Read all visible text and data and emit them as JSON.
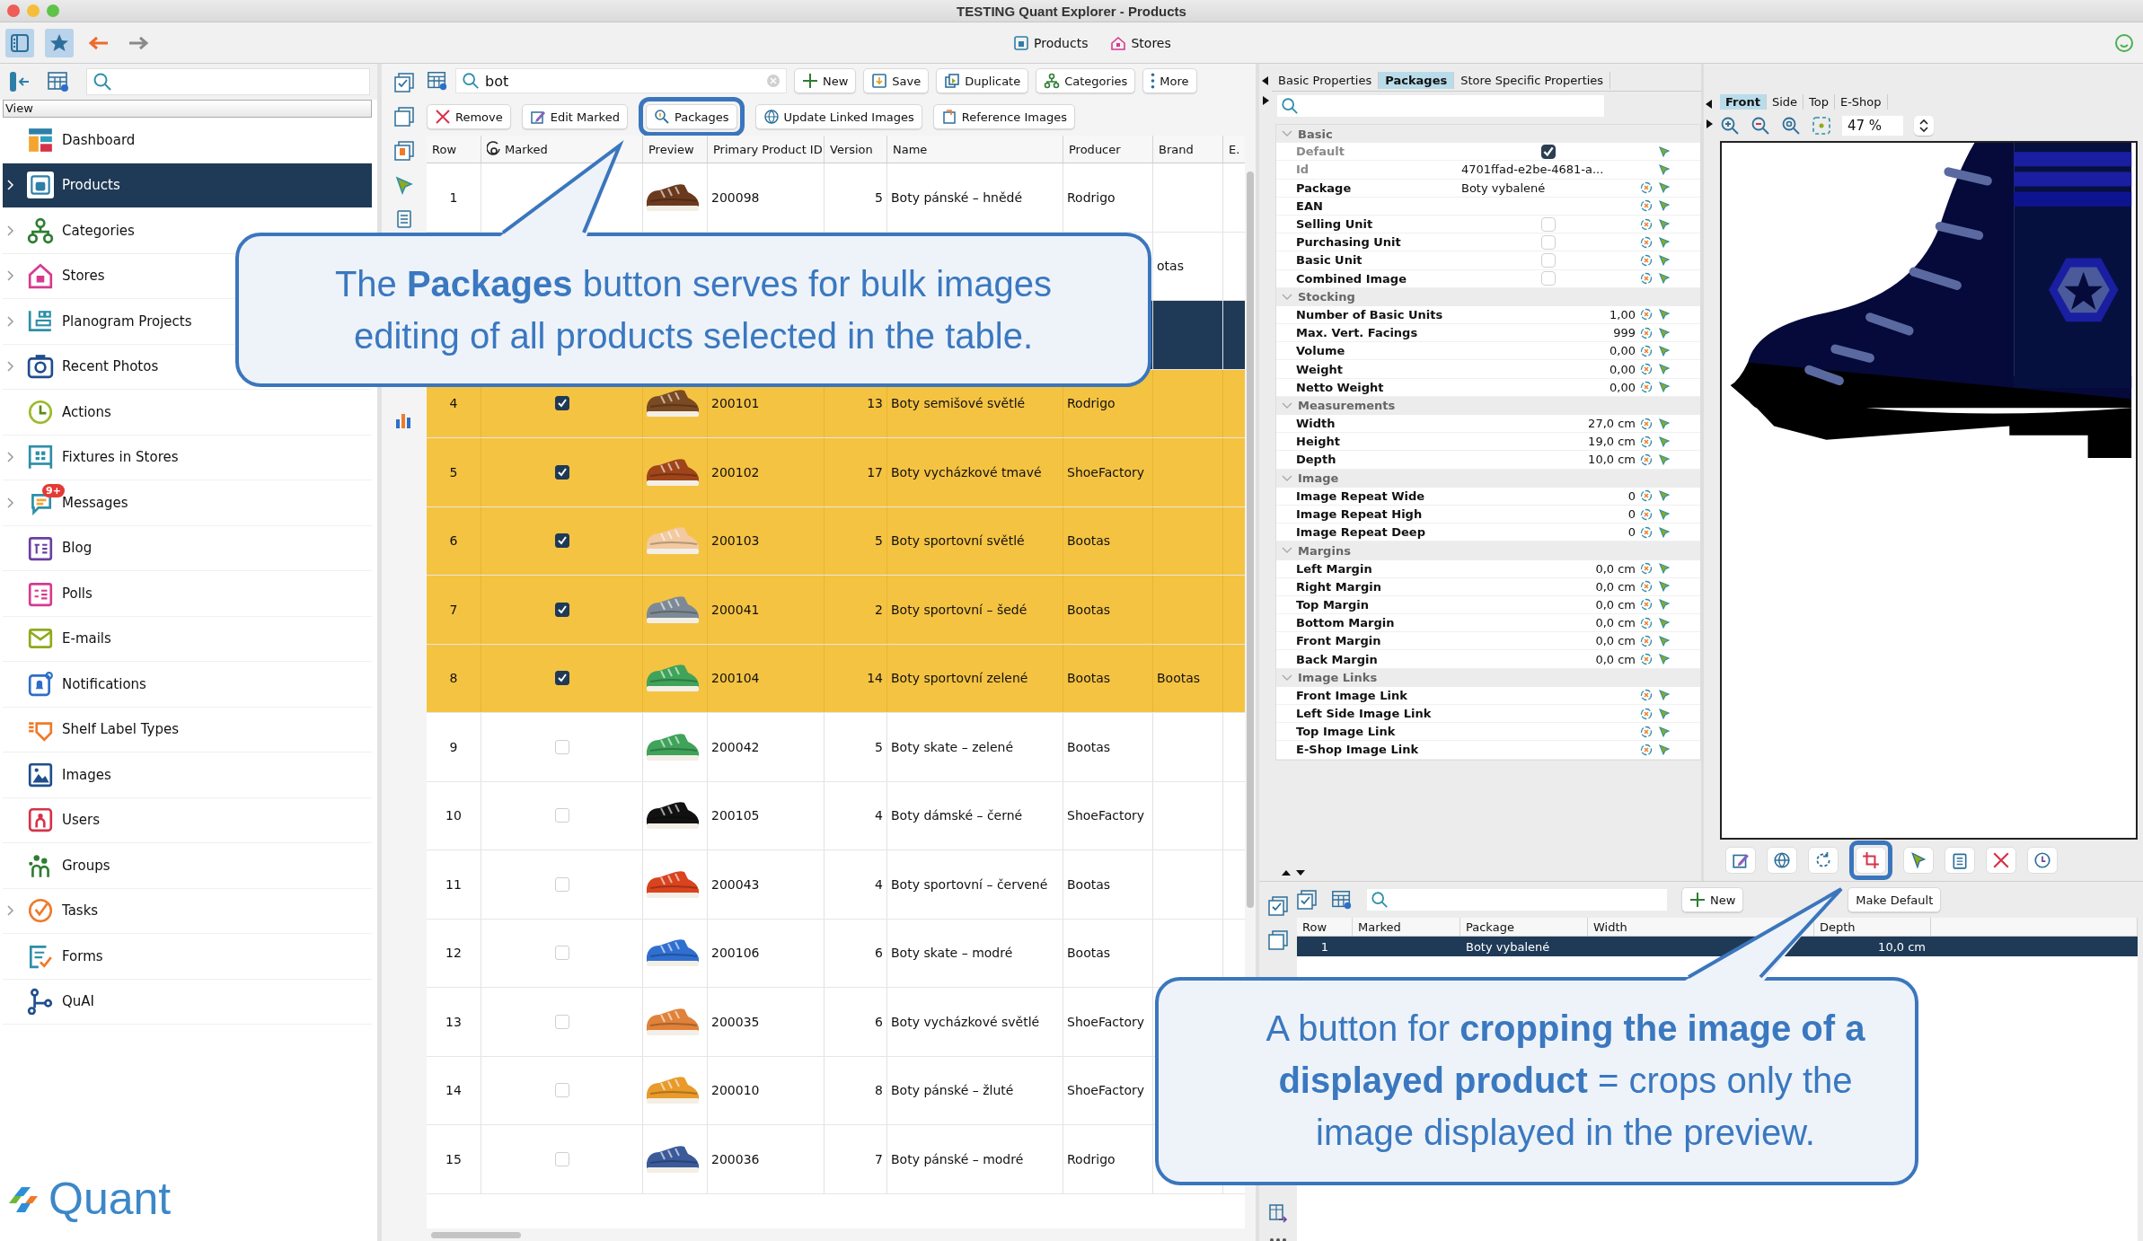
{
  "window": {
    "title": "TESTING Quant Explorer - Products"
  },
  "open_views": [
    {
      "label": "Products"
    },
    {
      "label": "Stores"
    }
  ],
  "sidebar": {
    "section": "View",
    "items": [
      {
        "label": "Dashboard",
        "expandable": false,
        "selected": false
      },
      {
        "label": "Products",
        "expandable": true,
        "selected": true
      },
      {
        "label": "Categories",
        "expandable": true,
        "selected": false
      },
      {
        "label": "Stores",
        "expandable": true,
        "selected": false
      },
      {
        "label": "Planogram Projects",
        "expandable": true,
        "selected": false
      },
      {
        "label": "Recent Photos",
        "expandable": true,
        "selected": false
      },
      {
        "label": "Actions",
        "expandable": false,
        "selected": false
      },
      {
        "label": "Fixtures in Stores",
        "expandable": true,
        "selected": false
      },
      {
        "label": "Messages",
        "expandable": true,
        "selected": false,
        "badge": "9+"
      },
      {
        "label": "Blog",
        "expandable": false,
        "selected": false
      },
      {
        "label": "Polls",
        "expandable": false,
        "selected": false
      },
      {
        "label": "E-mails",
        "expandable": false,
        "selected": false
      },
      {
        "label": "Notifications",
        "expandable": false,
        "selected": false
      },
      {
        "label": "Shelf Label Types",
        "expandable": false,
        "selected": false
      },
      {
        "label": "Images",
        "expandable": false,
        "selected": false
      },
      {
        "label": "Users",
        "expandable": false,
        "selected": false
      },
      {
        "label": "Groups",
        "expandable": false,
        "selected": false
      },
      {
        "label": "Tasks",
        "expandable": true,
        "selected": false
      },
      {
        "label": "Forms",
        "expandable": false,
        "selected": false
      },
      {
        "label": "QuAI",
        "expandable": false,
        "selected": false
      }
    ],
    "logo": "Quant"
  },
  "products": {
    "search": {
      "value": "bot"
    },
    "buttons": [
      {
        "label": "New",
        "kind": "new"
      },
      {
        "label": "Save",
        "kind": "save"
      },
      {
        "label": "Duplicate",
        "kind": "duplicate"
      },
      {
        "label": "Categories",
        "kind": "categories"
      },
      {
        "label": "More",
        "kind": "more"
      }
    ],
    "actions": [
      {
        "label": "Remove",
        "kind": "remove",
        "highlighted": false
      },
      {
        "label": "Edit Marked",
        "kind": "edit",
        "highlighted": false
      },
      {
        "label": "Packages",
        "kind": "packages",
        "highlighted": true
      },
      {
        "label": "Update Linked Images",
        "kind": "globe",
        "highlighted": false
      },
      {
        "label": "Reference Images",
        "kind": "reference",
        "highlighted": false
      }
    ],
    "table": {
      "columns": [
        "Row",
        "Marked",
        "Preview",
        "Primary Product ID",
        "Version",
        "Name",
        "Producer",
        "Brand",
        "E."
      ],
      "rows": [
        {
          "row": "1",
          "id": "200098",
          "version": "5",
          "name": "Boty pánské – hnědé",
          "producer": "Rodrigo",
          "selected": false
        },
        {
          "brand": "otas",
          "selected": false
        },
        {
          "selected": true
        },
        {
          "row": "4",
          "marked": true,
          "id": "200101",
          "version": "13",
          "name": "Boty semišové světlé",
          "producer": "Rodrigo",
          "selected": false
        },
        {
          "row": "5",
          "marked": true,
          "id": "200102",
          "version": "17",
          "name": "Boty vycházkové tmavé",
          "producer": "ShoeFactory",
          "selected": false
        },
        {
          "row": "6",
          "marked": true,
          "id": "200103",
          "version": "5",
          "name": "Boty sportovní světlé",
          "producer": "Bootas",
          "selected": false
        },
        {
          "row": "7",
          "marked": true,
          "id": "200041",
          "version": "2",
          "name": "Boty sportovní – šedé",
          "producer": "Bootas",
          "selected": false
        },
        {
          "row": "8",
          "marked": true,
          "id": "200104",
          "version": "14",
          "name": "Boty sportovní zelené",
          "producer": "Bootas",
          "brand": "Bootas",
          "selected": false
        },
        {
          "row": "9",
          "marked": false,
          "id": "200042",
          "version": "5",
          "name": "Boty skate – zelené",
          "producer": "Bootas",
          "selected": false
        },
        {
          "row": "10",
          "marked": false,
          "id": "200105",
          "version": "4",
          "name": "Boty dámské – černé",
          "producer": "ShoeFactory",
          "selected": false
        },
        {
          "row": "11",
          "marked": false,
          "id": "200043",
          "version": "4",
          "name": "Boty sportovní – červené",
          "producer": "Bootas",
          "selected": false
        },
        {
          "row": "12",
          "marked": false,
          "id": "200106",
          "version": "6",
          "name": "Boty skate – modré",
          "producer": "Bootas",
          "selected": false
        },
        {
          "row": "13",
          "marked": false,
          "id": "200035",
          "version": "6",
          "name": "Boty vycházkové světlé",
          "producer": "ShoeFactory",
          "selected": false
        },
        {
          "row": "14",
          "marked": false,
          "id": "200010",
          "version": "8",
          "name": "Boty pánské – žluté",
          "producer": "ShoeFactory",
          "selected": false
        },
        {
          "row": "15",
          "marked": false,
          "id": "200036",
          "version": "7",
          "name": "Boty pánské – modré",
          "producer": "Rodrigo",
          "selected": false
        }
      ]
    }
  },
  "properties": {
    "tabs": [
      {
        "label": "Basic Properties",
        "selected": false
      },
      {
        "label": "Packages",
        "selected": true
      },
      {
        "label": "Store Specific Properties",
        "selected": false
      }
    ],
    "groups": [
      {
        "title": "Basic",
        "expanded": true,
        "rows": [
          {
            "label": "Default",
            "kind": "checkbox",
            "checked": true,
            "disabled": true,
            "resettable": false
          },
          {
            "label": "Id",
            "kind": "text",
            "value": "4701ffad-e2be-4681-a...",
            "disabled": true,
            "resettable": false
          },
          {
            "label": "Package",
            "kind": "text",
            "value": "Boty vybalené",
            "disabled": false,
            "resettable": true
          },
          {
            "label": "EAN",
            "kind": "text",
            "disabled": false,
            "resettable": true
          },
          {
            "label": "Selling Unit",
            "kind": "checkbox",
            "checked": false,
            "disabled": false,
            "resettable": true
          },
          {
            "label": "Purchasing Unit",
            "kind": "checkbox",
            "checked": false,
            "disabled": false,
            "resettable": true
          },
          {
            "label": "Basic Unit",
            "kind": "checkbox",
            "checked": false,
            "disabled": false,
            "resettable": true
          },
          {
            "label": "Combined Image",
            "kind": "checkbox",
            "checked": false,
            "disabled": false,
            "resettable": true
          }
        ]
      },
      {
        "title": "Stocking",
        "expanded": true,
        "rows": [
          {
            "label": "Number of Basic Units",
            "kind": "number",
            "value": "1,00",
            "disabled": false,
            "resettable": true
          },
          {
            "label": "Max. Vert. Facings",
            "kind": "number",
            "value": "999",
            "disabled": false,
            "resettable": true
          },
          {
            "label": "Volume",
            "kind": "number",
            "value": "0,00",
            "disabled": false,
            "resettable": true
          },
          {
            "label": "Weight",
            "kind": "number",
            "value": "0,00",
            "disabled": false,
            "resettable": true
          },
          {
            "label": "Netto Weight",
            "kind": "number",
            "value": "0,00",
            "disabled": false,
            "resettable": true
          }
        ]
      },
      {
        "title": "Measurements",
        "expanded": true,
        "rows": [
          {
            "label": "Width",
            "kind": "number",
            "value": "27,0 cm",
            "disabled": false,
            "resettable": true
          },
          {
            "label": "Height",
            "kind": "number",
            "value": "19,0 cm",
            "disabled": false,
            "resettable": true
          },
          {
            "label": "Depth",
            "kind": "number",
            "value": "10,0 cm",
            "disabled": false,
            "resettable": true
          }
        ]
      },
      {
        "title": "Image",
        "expanded": true,
        "rows": [
          {
            "label": "Image Repeat Wide",
            "kind": "number",
            "value": "0",
            "disabled": false,
            "resettable": true
          },
          {
            "label": "Image Repeat High",
            "kind": "number",
            "value": "0",
            "disabled": false,
            "resettable": true
          },
          {
            "label": "Image Repeat Deep",
            "kind": "number",
            "value": "0",
            "disabled": false,
            "resettable": true
          }
        ]
      },
      {
        "title": "Margins",
        "expanded": true,
        "rows": [
          {
            "label": "Left Margin",
            "kind": "number",
            "value": "0,0 cm",
            "disabled": false,
            "resettable": true
          },
          {
            "label": "Right Margin",
            "kind": "number",
            "value": "0,0 cm",
            "disabled": false,
            "resettable": true
          },
          {
            "label": "Top Margin",
            "kind": "number",
            "value": "0,0 cm",
            "disabled": false,
            "resettable": true
          },
          {
            "label": "Bottom Margin",
            "kind": "number",
            "value": "0,0 cm",
            "disabled": false,
            "resettable": true
          },
          {
            "label": "Front Margin",
            "kind": "number",
            "value": "0,0 cm",
            "disabled": false,
            "resettable": true
          },
          {
            "label": "Back Margin",
            "kind": "number",
            "value": "0,0 cm",
            "disabled": false,
            "resettable": true
          }
        ]
      },
      {
        "title": "Image Links",
        "expanded": true,
        "rows": [
          {
            "label": "Front Image Link",
            "kind": "text",
            "disabled": false,
            "resettable": true
          },
          {
            "label": "Left Side Image Link",
            "kind": "text",
            "disabled": false,
            "resettable": true
          },
          {
            "label": "Top Image Link",
            "kind": "text",
            "disabled": false,
            "resettable": true
          },
          {
            "label": "E-Shop Image Link",
            "kind": "text",
            "disabled": false,
            "resettable": true
          }
        ]
      }
    ]
  },
  "image_view": {
    "tabs": [
      {
        "label": "Front",
        "selected": true
      },
      {
        "label": "Side",
        "selected": false
      },
      {
        "label": "Top",
        "selected": false
      },
      {
        "label": "E-Shop",
        "selected": false
      }
    ],
    "zoom": "47 %",
    "actions": [
      {
        "kind": "edit",
        "highlighted": false
      },
      {
        "kind": "globe",
        "highlighted": false
      },
      {
        "kind": "refresh",
        "highlighted": false
      },
      {
        "kind": "crop",
        "highlighted": true
      },
      {
        "kind": "cursor",
        "highlighted": false
      },
      {
        "kind": "clipboard",
        "highlighted": false
      },
      {
        "kind": "delete",
        "highlighted": false
      },
      {
        "kind": "history",
        "highlighted": false
      }
    ]
  },
  "packages_table": {
    "buttons": [
      {
        "label": "New",
        "kind": "new"
      },
      {
        "label": "Make Default",
        "kind": "plain"
      }
    ],
    "columns": [
      "Row",
      "Marked",
      "Package",
      "Width",
      "Depth"
    ],
    "rows": [
      {
        "row": "1",
        "package": "Boty vybalené",
        "depth": "10,0 cm",
        "selected": true
      }
    ]
  },
  "callouts": [
    {
      "text": "The **Packages** button serves for bulk images editing of all products selected in the table."
    },
    {
      "text": "A button for **cropping the image of a displayed product** = crops only the image displayed in the preview."
    }
  ]
}
